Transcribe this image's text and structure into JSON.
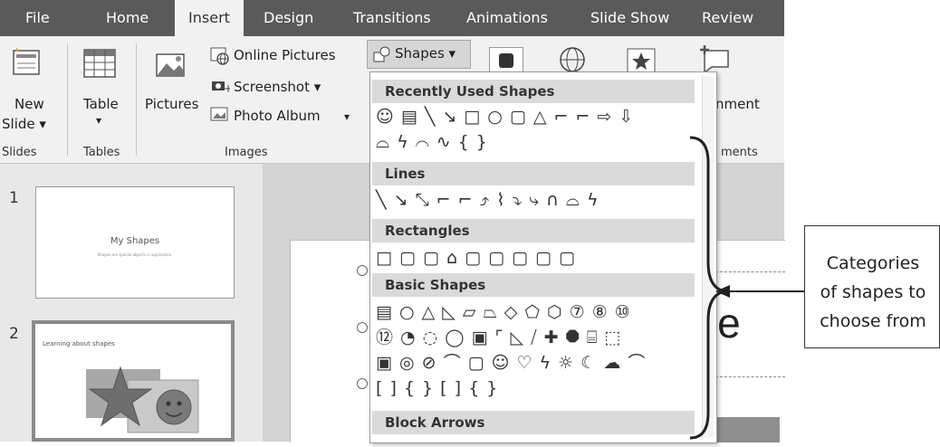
{
  "ribbon_tabs": [
    "File",
    "Home",
    "Insert",
    "Design",
    "Transitions",
    "Animations",
    "Slide Show",
    "Review"
  ],
  "active_tab": "Insert",
  "slides_group": {
    "new_slide_line1": "New",
    "new_slide_line2": "Slide ▾",
    "label": "Slides"
  },
  "tables_group": {
    "table": "Table",
    "table_arrow": "▾",
    "label": "Tables"
  },
  "images_group": {
    "pictures": "Pictures",
    "online_pictures": "Online Pictures",
    "screenshot": "Screenshot ▾",
    "photo_album": "Photo Album",
    "photo_album_arrow": "▾",
    "label": "Images"
  },
  "shapes_button": "Shapes ▾",
  "comment_partial": "nment",
  "comments_group_partial": "ments",
  "shapes_menu": {
    "categories": [
      {
        "title": "Recently Used Shapes",
        "rows": [
          "☺ ▤ ╲ ↘ □ ○ ▢ △ ⌐ ⌐ ⇨ ⇩",
          "⌓ ϟ ⌒ ∿ {  }"
        ]
      },
      {
        "title": "Lines",
        "rows": [
          "╲ ↘ ⤡ ⌐ ⌐ ⤴ ⌇ ⤵ ⤷ ∩ ⌓ ϟ"
        ]
      },
      {
        "title": "Rectangles",
        "rows": [
          "□ ▢ ▢ ⌂ ▢ ▢ ▢ ▢ ▢"
        ]
      },
      {
        "title": "Basic Shapes",
        "rows": [
          "▤ ○ △ ◺ ▱ ⏢ ◇ ⬠ ⬡ ⑦ ⑧ ⑩",
          "⑫ ◔ ◌ ◯ ▣ ⌜ ◺ ⧸ ✚ ⯃ ⌸ ⬚",
          "▣ ◎ ⊘ ⌒ ▢ ☺ ♡ ϟ ☼ ☾ ☁ ⌒",
          "[ ] { } [   ] {   }"
        ]
      },
      {
        "title": "Block Arrows",
        "rows": []
      }
    ]
  },
  "thumbnails": [
    {
      "number": "1",
      "title": "My Shapes",
      "subtitle": "Shapes are special objects in application."
    },
    {
      "number": "2",
      "title": "Learning about shapes"
    }
  ],
  "slide_partial_text": "ape",
  "callout": {
    "lines": [
      "Categories",
      "of shapes to",
      "choose from"
    ]
  }
}
